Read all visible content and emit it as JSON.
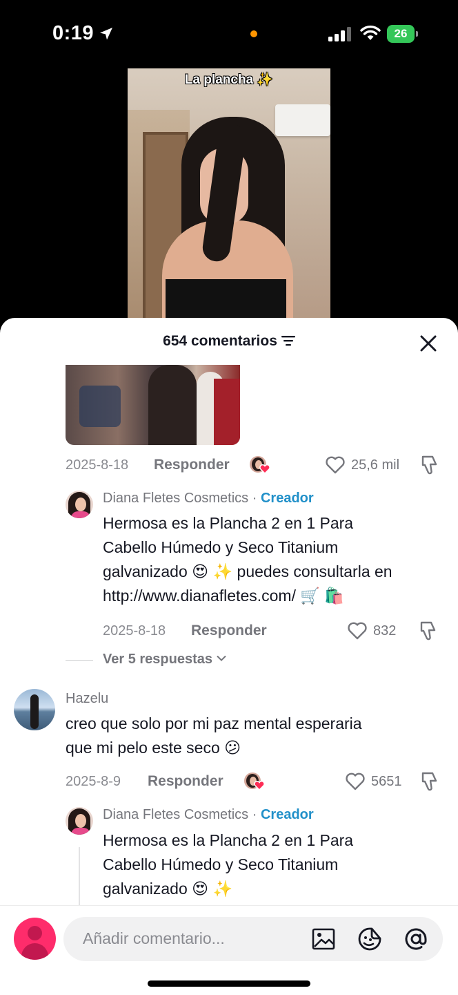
{
  "status_bar": {
    "time": "0:19",
    "battery": "26"
  },
  "video": {
    "title": "La plancha",
    "title_emoji": "✨"
  },
  "comments_header": {
    "count_label": "654 comentarios"
  },
  "comments": [
    {
      "date": "2025-8-18",
      "reply_label": "Responder",
      "likes": "25,6 mil",
      "has_image": true,
      "replies": [
        {
          "author": "Diana Fletes Cosmetics",
          "badge": "Creador",
          "lines": [
            "Hermosa es la Plancha 2 en 1 Para",
            "Cabello Húmedo y Seco Titanium",
            "galvanizado 😍 ✨ puedes consultarla en",
            "http://www.dianafletes.com/ 🛒 🛍️"
          ],
          "date": "2025-8-18",
          "reply_label": "Responder",
          "likes": "832"
        }
      ],
      "view_replies": "Ver 5 respuestas"
    },
    {
      "author": "Hazelu",
      "lines": [
        "creo que solo por mi paz mental esperaria",
        "que mi pelo este seco 😕"
      ],
      "date": "2025-8-9",
      "reply_label": "Responder",
      "likes": "5651",
      "replies": [
        {
          "author": "Diana Fletes Cosmetics",
          "badge": "Creador",
          "lines": [
            "Hermosa es la Plancha 2 en 1 Para",
            "Cabello Húmedo y Seco Titanium",
            "galvanizado 😍 ✨"
          ]
        }
      ]
    }
  ],
  "input": {
    "placeholder": "Añadir comentario..."
  },
  "colors": {
    "accent": "#fe2c6b",
    "creator": "#2190c9",
    "battery": "#34c759"
  },
  "icons": [
    "location-arrow-icon",
    "signal-icon",
    "wifi-icon",
    "filter-icon",
    "close-icon",
    "heart-icon",
    "dislike-icon",
    "image-icon",
    "sticker-icon",
    "mention-icon",
    "chevron-down-icon"
  ]
}
